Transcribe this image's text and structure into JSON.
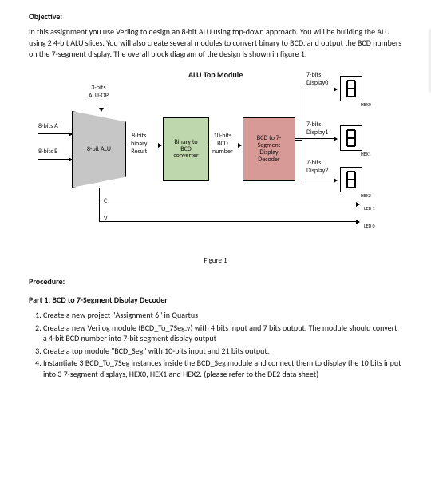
{
  "section_objective": "Objective:",
  "objective_text": "In this assignment you use Verilog to design an 8-bit ALU using top-down approach. You will be building the ALU using 2 4-bit ALU slices. You will also create several modules to convert binary to BCD, and output the BCD numbers on the 7-segment display.  The overall block diagram of the design is shown in figure 1.",
  "diagram": {
    "title": "ALU Top Module",
    "alu_op": "3-bits\nALU-OP",
    "in_a": "8-bits A",
    "in_b": "8-bits B",
    "alu_box": "8-bit ALU",
    "alu_out": "8-bits\nbinary\nResult",
    "bin_bcd": "Binary to\nBCD\nconverter",
    "bcd_num": "10-bits\nBCD\nnumber",
    "decoder": "BCD to 7-\nSegment\nDisplay\nDecoder",
    "d0": "7-bits\nDisplay0",
    "d1": "7-bits\nDisplay1",
    "d2": "7-bits\nDisplay2",
    "hex0": "HEX0",
    "hex1": "HEX1",
    "hex2": "HEX2",
    "c": "C",
    "v": "V",
    "led1": "LED 1",
    "led0": "LED 0",
    "caption": "Figure 1"
  },
  "section_procedure": "Procedure:",
  "part1_heading": "Part 1: BCD to 7-Segment Display Decoder",
  "steps": [
    "Create a new project \"Assignment 6\" in Quartus",
    "Create a new Verilog module (BCD_To_7Seg.v) with 4 bits input and 7 bits output. The module should convert a 4-bit BCD number into 7-bit segment display output",
    "Create a top module \"BCD_Seg\" with 10-bits input and 21 bits output.",
    "Instantiate 3 BCD_To_7Seg instances inside the BCD_Seg module and connect them to display the 10 bits input into 3 7-segment displays, HEX0, HEX1 and HEX2. (please refer to the DE2 data sheet)"
  ]
}
